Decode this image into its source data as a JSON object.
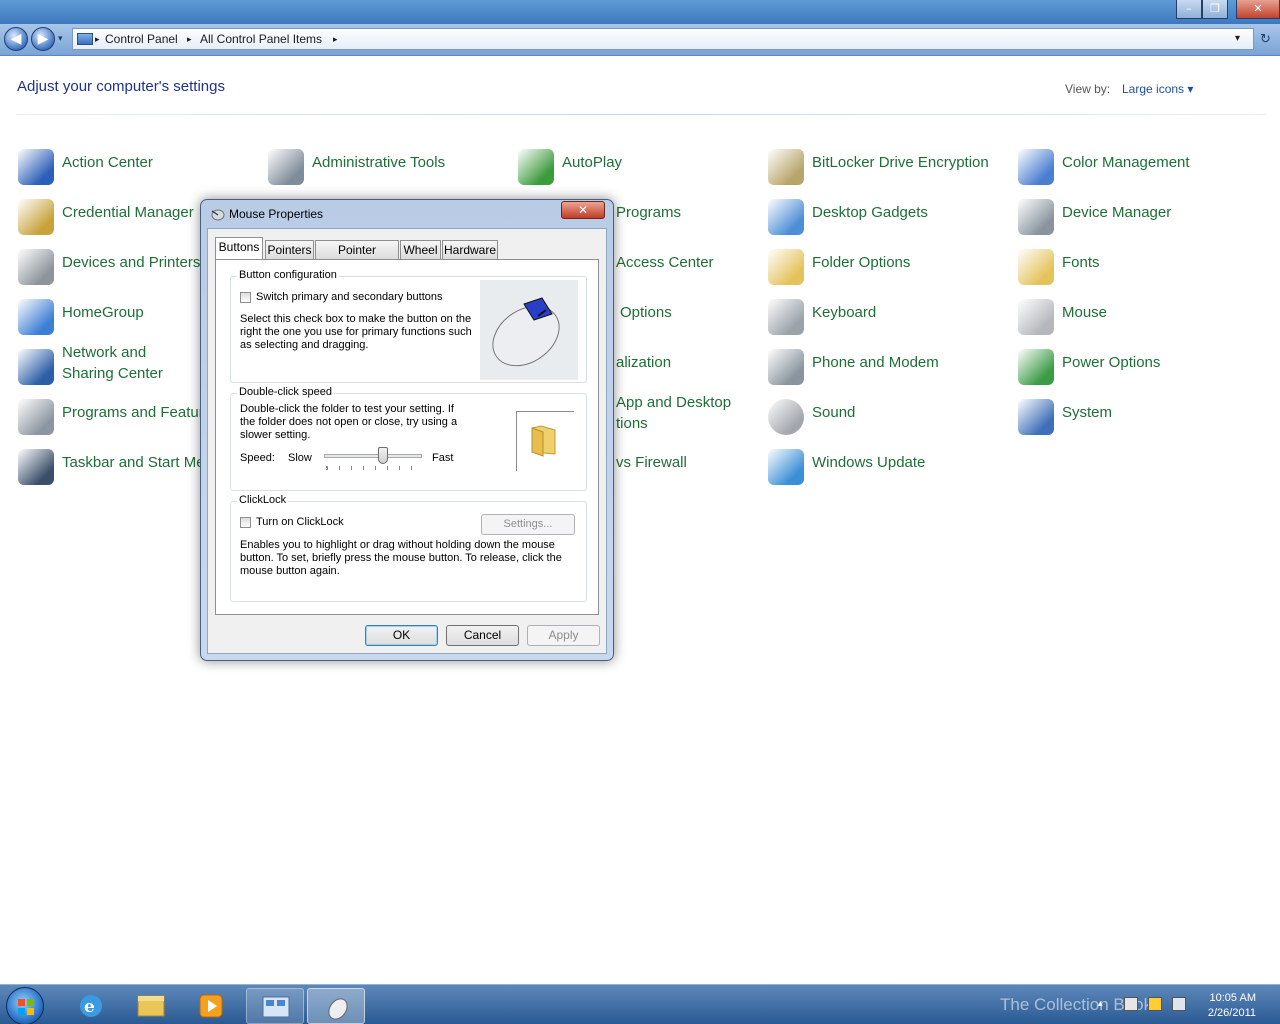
{
  "window": {
    "minimize": "–",
    "restore": "❐",
    "close": "✕"
  },
  "nav": {
    "back": "◀",
    "forward": "▶"
  },
  "address": {
    "segments": [
      "Control Panel",
      "All Control Panel Items"
    ],
    "separator": "▸",
    "dropdown": "▾",
    "refresh": "↻"
  },
  "content": {
    "heading": "Adjust your computer's settings",
    "view_by_label": "View by:",
    "view_by_value": "Large icons ▾"
  },
  "items": [
    {
      "label": "Action Center",
      "icon": "flag-icon",
      "color": "#2d5fb8"
    },
    {
      "label": "Administrative Tools",
      "icon": "gears-icon",
      "color": "#7f8c99"
    },
    {
      "label": "AutoPlay",
      "icon": "autoplay-icon",
      "color": "#3c9b3c"
    },
    {
      "label": "BitLocker Drive Encryption",
      "icon": "key-icon",
      "color": "#b8a56a"
    },
    {
      "label": "Color Management",
      "icon": "color-icon",
      "color": "#4a7fd0"
    },
    {
      "label": "Credential Manager",
      "icon": "vault-icon",
      "color": "#c8a23b"
    },
    {
      "label": "Programs",
      "icon": "programs-icon",
      "color": "#3c8a6a"
    },
    {
      "label": "Desktop Gadgets",
      "icon": "gadgets-icon",
      "color": "#4d8fd6"
    },
    {
      "label": "Device Manager",
      "icon": "device-manager-icon",
      "color": "#8a949e"
    },
    {
      "label": "Devices and Printers",
      "icon": "printer-icon",
      "color": "#8d949a"
    },
    {
      "label": "Access Center",
      "icon": "access-icon",
      "color": "#3b7ed0"
    },
    {
      "label": "Folder Options",
      "icon": "folder-icon",
      "color": "#e4c35c"
    },
    {
      "label": "Fonts",
      "icon": "fonts-icon",
      "color": "#e4c35c"
    },
    {
      "label": "HomeGroup",
      "icon": "homegroup-icon",
      "color": "#3e7fd6"
    },
    {
      "label": "Options",
      "icon": "options-icon",
      "color": "#6a8fc0"
    },
    {
      "label": "Keyboard",
      "icon": "keyboard-icon",
      "color": "#9aa2aa"
    },
    {
      "label": "Mouse",
      "icon": "mouse-icon",
      "color": "#b4b8bd"
    },
    {
      "label": "Network and Sharing Center",
      "icon": "network-icon",
      "color": "#2c5fa6"
    },
    {
      "label": "alization",
      "icon": "personalization-icon",
      "color": "#6da0d8"
    },
    {
      "label": "Phone and Modem",
      "icon": "phone-icon",
      "color": "#8a949e"
    },
    {
      "label": "Power Options",
      "icon": "power-icon",
      "color": "#3b9b46"
    },
    {
      "label": "Programs and Features",
      "icon": "programs-features-icon",
      "color": "#8c96a0"
    },
    {
      "label": "App and Desktop tions",
      "icon": "remoteapp-icon",
      "color": "#4c82c8"
    },
    {
      "label": "Sound",
      "icon": "speaker-icon",
      "color": "#a0a6ac"
    },
    {
      "label": "System",
      "icon": "system-icon",
      "color": "#3e6fb8"
    },
    {
      "label": "Taskbar and Start Menu",
      "icon": "taskbar-icon",
      "color": "#3b4f6a"
    },
    {
      "label": "vs Firewall",
      "icon": "firewall-icon",
      "color": "#b7583b"
    },
    {
      "label": "Windows Update",
      "icon": "windows-update-icon",
      "color": "#3a8fd6"
    }
  ],
  "dialog": {
    "title": "Mouse Properties",
    "close": "✕",
    "tabs": [
      "Buttons",
      "Pointers",
      "Pointer Options",
      "Wheel",
      "Hardware"
    ],
    "button_config": {
      "legend": "Button configuration",
      "checkbox_label": "Switch primary and secondary buttons",
      "description": "Select this check box to make the button on the right the one you use for primary functions such as selecting and dragging."
    },
    "double_click": {
      "legend": "Double-click speed",
      "description": "Double-click the folder to test your setting. If the folder does not open or close, try using a slower setting.",
      "speed_label": "Speed:",
      "slow": "Slow",
      "fast": "Fast",
      "speed_value": 0.6
    },
    "clicklock": {
      "legend": "ClickLock",
      "checkbox_label": "Turn on ClickLock",
      "settings_button": "Settings...",
      "description": "Enables you to highlight or drag without holding down the mouse button. To set, briefly press the mouse button. To release, click the mouse button again."
    },
    "buttons": {
      "ok": "OK",
      "cancel": "Cancel",
      "apply": "Apply"
    }
  },
  "taskbar": {
    "time": "10:05 AM",
    "date": "2/26/2011",
    "watermark": "The Collection Book"
  }
}
